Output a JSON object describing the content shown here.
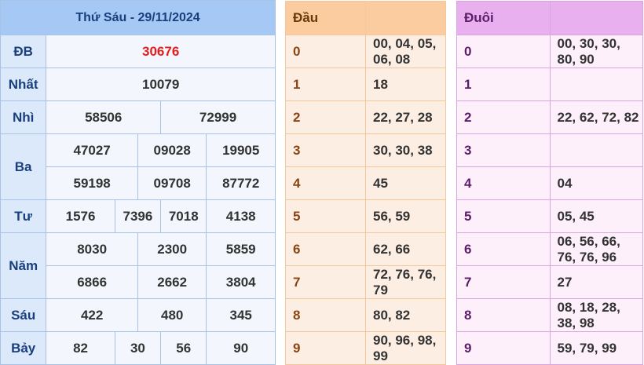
{
  "results": {
    "title": "Thứ Sáu - 29/11/2024",
    "rows": [
      {
        "label": "ĐB",
        "values": [
          "30676"
        ]
      },
      {
        "label": "Nhất",
        "values": [
          "10079"
        ]
      },
      {
        "label": "Nhì",
        "values": [
          "58506",
          "72999"
        ]
      },
      {
        "label": "Ba",
        "values": [
          "47027",
          "09028",
          "19905",
          "59198",
          "09708",
          "87772"
        ]
      },
      {
        "label": "Tư",
        "values": [
          "1576",
          "7396",
          "7018",
          "4138"
        ]
      },
      {
        "label": "Năm",
        "values": [
          "8030",
          "2300",
          "5859",
          "6866",
          "2662",
          "3804"
        ]
      },
      {
        "label": "Sáu",
        "values": [
          "422",
          "480",
          "345"
        ]
      },
      {
        "label": "Bảy",
        "values": [
          "82",
          "30",
          "56",
          "90"
        ]
      }
    ]
  },
  "dau": {
    "header": "Đầu",
    "rows": [
      {
        "key": "0",
        "values": "00, 04, 05, 06, 08"
      },
      {
        "key": "1",
        "values": "18"
      },
      {
        "key": "2",
        "values": "22, 27, 28"
      },
      {
        "key": "3",
        "values": "30, 30, 38"
      },
      {
        "key": "4",
        "values": "45"
      },
      {
        "key": "5",
        "values": "56, 59"
      },
      {
        "key": "6",
        "values": "62, 66"
      },
      {
        "key": "7",
        "values": "72, 76, 76, 79"
      },
      {
        "key": "8",
        "values": "80, 82"
      },
      {
        "key": "9",
        "values": "90, 96, 98, 99"
      }
    ]
  },
  "duoi": {
    "header": "Đuôi",
    "rows": [
      {
        "key": "0",
        "values": "00, 30, 30, 80, 90"
      },
      {
        "key": "1",
        "values": ""
      },
      {
        "key": "2",
        "values": "22, 62, 72, 82"
      },
      {
        "key": "3",
        "values": ""
      },
      {
        "key": "4",
        "values": "04"
      },
      {
        "key": "5",
        "values": "05, 45"
      },
      {
        "key": "6",
        "values": "06, 56, 66, 76, 76, 96"
      },
      {
        "key": "7",
        "values": "27"
      },
      {
        "key": "8",
        "values": "08, 18, 28, 38, 98"
      },
      {
        "key": "9",
        "values": "59, 79, 99"
      }
    ]
  },
  "colors": {
    "special_prize": "#e41e1e",
    "results_header": "#a6c8f4",
    "dau_header": "#fbcc9f",
    "duoi_header": "#e8b0ee"
  }
}
